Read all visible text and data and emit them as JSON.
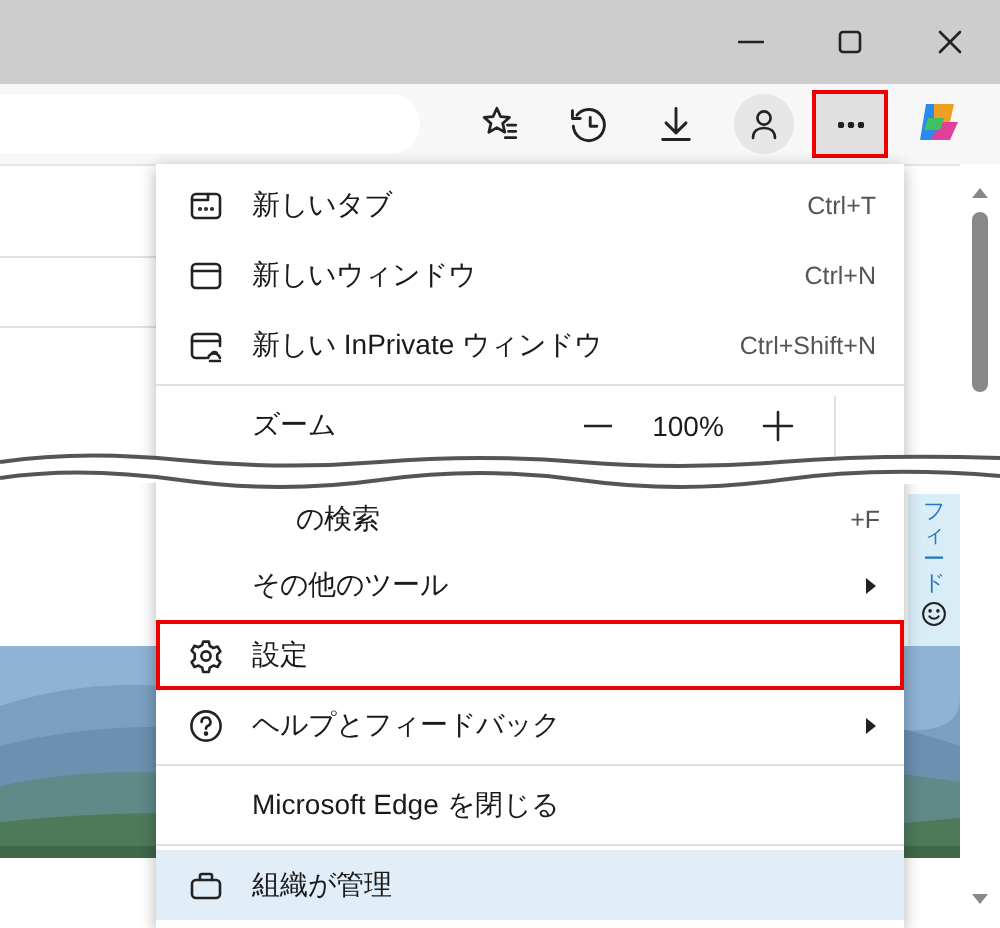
{
  "toolbar": {
    "more_button": {
      "highlighted": true
    }
  },
  "menu": {
    "items": [
      {
        "kind": "item",
        "label": "新しいタブ",
        "shortcut": "Ctrl+T",
        "highlighted": false,
        "selected": false
      },
      {
        "kind": "item",
        "label": "新しいウィンドウ",
        "shortcut": "Ctrl+N",
        "highlighted": false,
        "selected": false
      },
      {
        "kind": "item",
        "label": "新しい InPrivate ウィンドウ",
        "shortcut": "Ctrl+Shift+N",
        "highlighted": false,
        "selected": false
      },
      {
        "kind": "divider"
      },
      {
        "kind": "zoom",
        "label": "ズーム",
        "value": "100%"
      },
      {
        "kind": "fragment",
        "label": "の検索",
        "shortcut": "+F"
      },
      {
        "kind": "item",
        "label": "その他のツール",
        "submenu": true,
        "highlighted": false,
        "selected": false
      },
      {
        "kind": "item",
        "label": "設定",
        "highlighted": true,
        "selected": false
      },
      {
        "kind": "item",
        "label": "ヘルプとフィードバック",
        "submenu": true,
        "highlighted": false,
        "selected": false
      },
      {
        "kind": "divider"
      },
      {
        "kind": "item",
        "label": "Microsoft Edge を閉じる",
        "highlighted": false,
        "selected": false
      },
      {
        "kind": "divider"
      },
      {
        "kind": "item",
        "label": "組織が管理",
        "highlighted": false,
        "selected": true
      }
    ]
  },
  "feedback_tab": {
    "label": "フィード"
  }
}
